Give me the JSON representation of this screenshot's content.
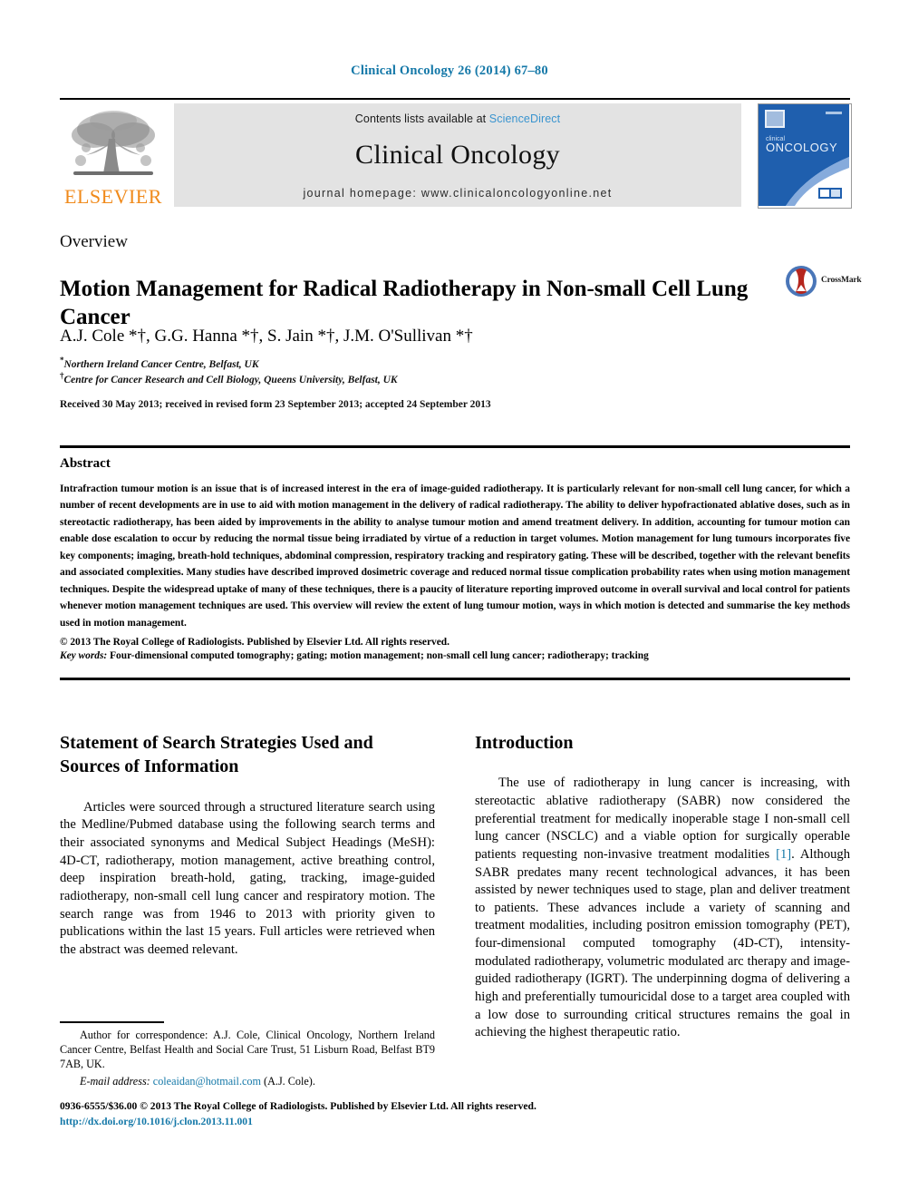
{
  "running_citation": "Clinical Oncology 26 (2014) 67–80",
  "masthead": {
    "contents_prefix": "Contents lists available at ",
    "sciencedirect_link": "ScienceDirect",
    "journal_title": "Clinical Oncology",
    "homepage_line": "journal homepage: www.clinicaloncologyonline.net",
    "publisher_logo_word": "ELSEVIER",
    "cover_title_small": "clinical",
    "cover_title_large": "ONCOLOGY"
  },
  "article": {
    "kicker": "Overview",
    "title": "Motion Management for Radical Radiotherapy in Non-small Cell Lung Cancer",
    "crossmark_label": "CrossMark",
    "authors": "A.J. Cole *†, G.G. Hanna *†, S. Jain *†, J.M. O'Sullivan *†",
    "affiliation_1": "Northern Ireland Cancer Centre, Belfast, UK",
    "affiliation_2": "Centre for Cancer Research and Cell Biology, Queens University, Belfast, UK",
    "history": "Received 30 May 2013; received in revised form 23 September 2013; accepted 24 September 2013"
  },
  "abstract": {
    "heading": "Abstract",
    "body": "Intrafraction tumour motion is an issue that is of increased interest in the era of image-guided radiotherapy. It is particularly relevant for non-small cell lung cancer, for which a number of recent developments are in use to aid with motion management in the delivery of radical radiotherapy. The ability to deliver hypofractionated ablative doses, such as in stereotactic radiotherapy, has been aided by improvements in the ability to analyse tumour motion and amend treatment delivery. In addition, accounting for tumour motion can enable dose escalation to occur by reducing the normal tissue being irradiated by virtue of a reduction in target volumes. Motion management for lung tumours incorporates five key components; imaging, breath-hold techniques, abdominal compression, respiratory tracking and respiratory gating. These will be described, together with the relevant benefits and associated complexities. Many studies have described improved dosimetric coverage and reduced normal tissue complication probability rates when using motion management techniques. Despite the widespread uptake of many of these techniques, there is a paucity of literature reporting improved outcome in overall survival and local control for patients whenever motion management techniques are used. This overview will review the extent of lung tumour motion, ways in which motion is detected and summarise the key methods used in motion management.",
    "copyright": "© 2013 The Royal College of Radiologists. Published by Elsevier Ltd. All rights reserved.",
    "keywords_label": "Key words:",
    "keywords_value": "Four-dimensional computed tomography; gating; motion management; non-small cell lung cancer; radiotherapy; tracking"
  },
  "sections": {
    "left_heading": "Statement of Search Strategies Used and Sources of Information",
    "left_paragraph": "Articles were sourced through a structured literature search using the Medline/Pubmed database using the following search terms and their associated synonyms and Medical Subject Headings (MeSH): 4D-CT, radiotherapy, motion management, active breathing control, deep inspiration breath-hold, gating, tracking, image-guided radiotherapy, non-small cell lung cancer and respiratory motion. The search range was from 1946 to 2013 with priority given to publications within the last 15 years. Full articles were retrieved when the abstract was deemed relevant.",
    "right_heading": "Introduction",
    "right_paragraph_part1": "The use of radiotherapy in lung cancer is increasing, with stereotactic ablative radiotherapy (SABR) now considered the preferential treatment for medically inoperable stage I non-small cell lung cancer (NSCLC) and a viable option for surgically operable patients requesting non-invasive treatment modalities ",
    "right_reference": "[1]",
    "right_paragraph_part2": ". Although SABR predates many recent technological advances, it has been assisted by newer techniques used to stage, plan and deliver treatment to patients. These advances include a variety of scanning and treatment modalities, including positron emission tomography (PET), four-dimensional computed tomography (4D-CT), intensity-modulated radiotherapy, volumetric modulated arc therapy and image-guided radiotherapy (IGRT). The underpinning dogma of delivering a high and preferentially tumouricidal dose to a target area coupled with a low dose to surrounding critical structures remains the goal in achieving the highest therapeutic ratio."
  },
  "footnote": {
    "correspondence": "Author for correspondence: A.J. Cole, Clinical Oncology, Northern Ireland Cancer Centre, Belfast Health and Social Care Trust, 51 Lisburn Road, Belfast BT9 7AB, UK.",
    "email_label": "E-mail address:",
    "email_address": "coleaidan@hotmail.com",
    "email_suffix": "(A.J. Cole)."
  },
  "footer": {
    "copyright_line": "0936-6555/$36.00 © 2013 The Royal College of Radiologists. Published by Elsevier Ltd. All rights reserved.",
    "doi": "http://dx.doi.org/10.1016/j.clon.2013.11.001"
  },
  "colors": {
    "link_blue": "#1478a8",
    "sciencedirect_blue": "#3a94cf",
    "elsevier_orange": "#f08a1b",
    "panel_gray": "#e3e3e3",
    "cover_blue": "#1f5fae"
  }
}
